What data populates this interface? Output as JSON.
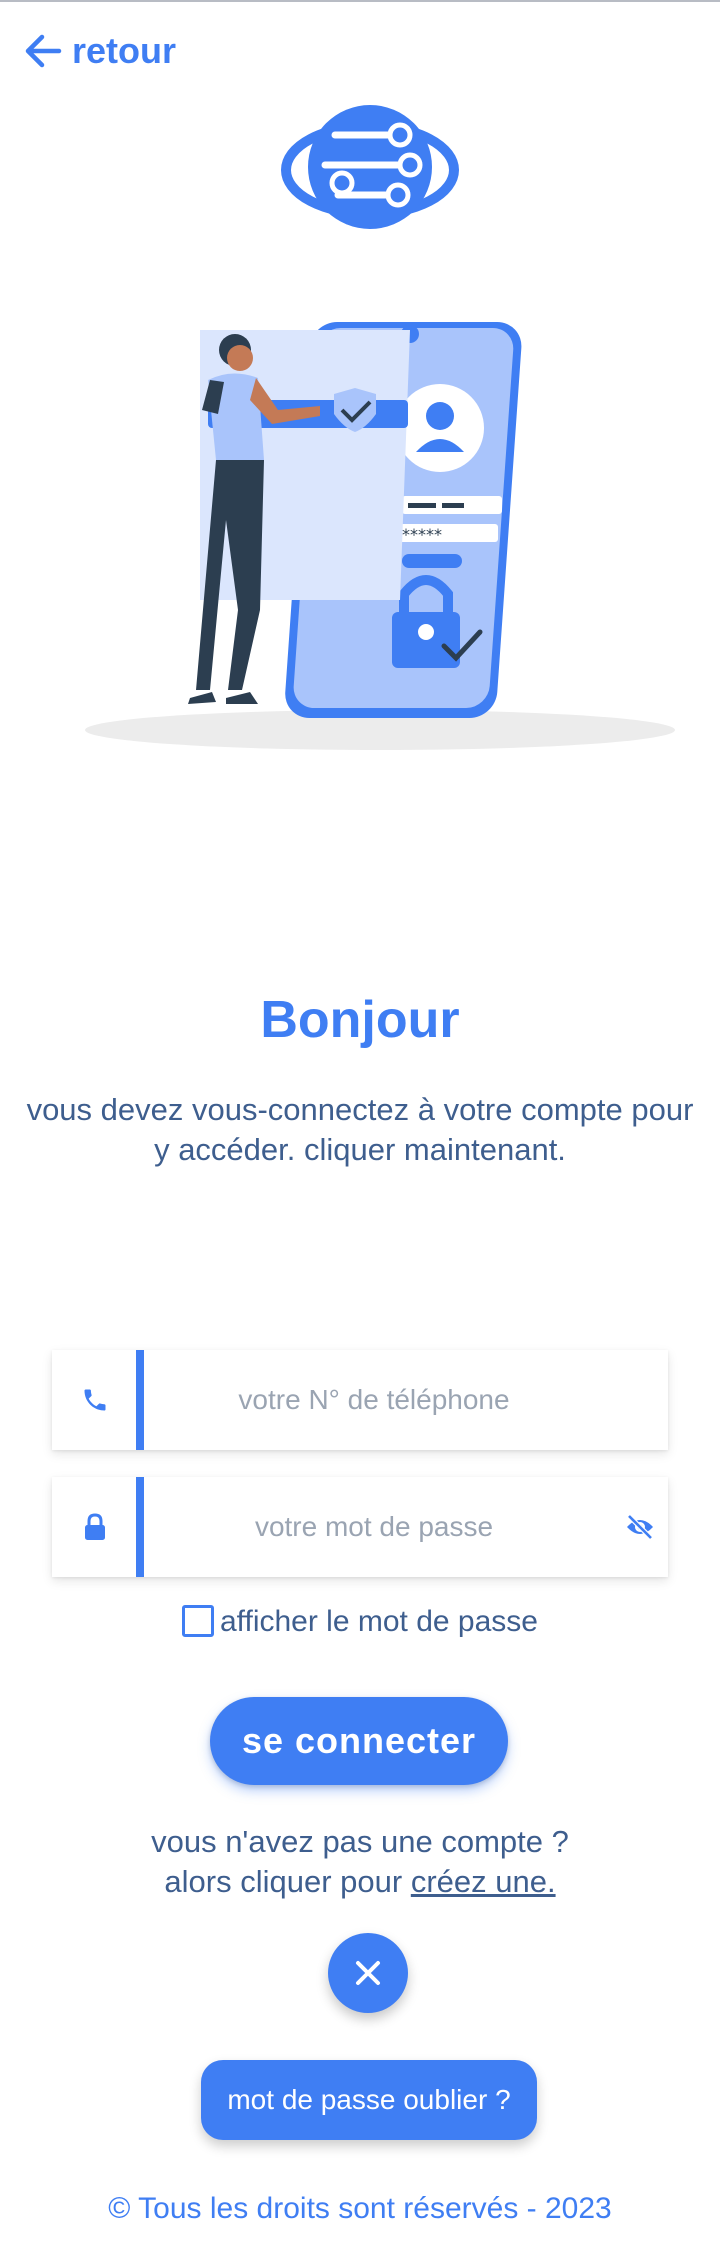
{
  "nav": {
    "back_label": "retour"
  },
  "heading": {
    "title": "Bonjour",
    "subtitle_line1": "vous devez vous-connectez à votre compte pour",
    "subtitle_line2": "y accéder. cliquer maintenant."
  },
  "form": {
    "phone": {
      "placeholder": "votre N° de téléphone",
      "value": ""
    },
    "password": {
      "placeholder": "votre mot de passe",
      "value": ""
    },
    "show_password_label": "afficher le mot de passe",
    "show_password_checked": false,
    "submit_label": "se connecter"
  },
  "signup": {
    "line1": "vous n'avez pas une compte ?",
    "line2_prefix": "alors cliquer pour ",
    "link_label": "créez une."
  },
  "forgot_label": "mot de passe oublier ?",
  "footer": "© Tous les droits sont réservés - 2023",
  "icons": {
    "back": "arrow-left-icon",
    "phone": "phone-icon",
    "lock": "lock-icon",
    "eye": "eye-off-icon",
    "close": "close-icon"
  },
  "colors": {
    "accent": "#3f7ef3",
    "text": "#3e5e8e"
  }
}
